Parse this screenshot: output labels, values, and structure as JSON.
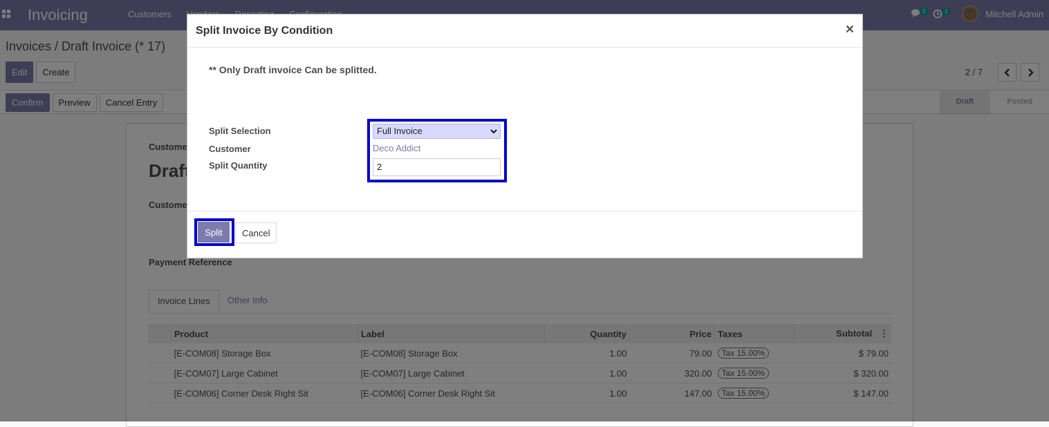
{
  "navbar": {
    "brand": "Invoicing",
    "menu": [
      "Customers",
      "Vendors",
      "Reporting",
      "Configuration"
    ],
    "messages_count": "5",
    "activities_count": "2",
    "user_name": "Mitchell Admin"
  },
  "breadcrumb": "Invoices / Draft Invoice (* 17)",
  "control": {
    "edit_label": "Edit",
    "create_label": "Create",
    "pager": "2 / 7"
  },
  "status": {
    "actions": [
      "Confirm",
      "Preview",
      "Cancel Entry"
    ],
    "stages": [
      "Draft",
      "Posted"
    ],
    "active_stage": "Draft"
  },
  "form": {
    "customer_invoice_label": "Customer Invoice",
    "title": "Draft",
    "customer_label": "Customer",
    "payment_reference_label": "Payment Reference",
    "tabs": [
      "Invoice Lines",
      "Other Info"
    ],
    "columns": [
      "Product",
      "Label",
      "Quantity",
      "Price",
      "Taxes",
      "Subtotal"
    ],
    "lines": [
      {
        "product": "[E-COM08] Storage Box",
        "label": "[E-COM08] Storage Box",
        "quantity": "1.00",
        "price": "79.00",
        "taxes": "Tax 15.00%",
        "subtotal": "$ 79.00"
      },
      {
        "product": "[E-COM07] Large Cabinet",
        "label": "[E-COM07] Large Cabinet",
        "quantity": "1.00",
        "price": "320.00",
        "taxes": "Tax 15.00%",
        "subtotal": "$ 320.00"
      },
      {
        "product": "[E-COM06] Corner Desk Right Sit",
        "label": "[E-COM06] Corner Desk Right Sit",
        "quantity": "1.00",
        "price": "147.00",
        "taxes": "Tax 15.00%",
        "subtotal": "$ 147.00"
      }
    ]
  },
  "modal": {
    "title": "Split Invoice By Condition",
    "close": "×",
    "note": "** Only Draft invoice Can be splitted.",
    "split_selection_label": "Split Selection",
    "split_selection_value": "Full Invoice",
    "customer_label": "Customer",
    "customer_value": "Deco Addict",
    "split_quantity_label": "Split Quantity",
    "split_quantity_value": "2",
    "split_button": "Split",
    "cancel_button": "Cancel"
  },
  "colors": {
    "brand": "#7c7bad",
    "highlight": "#0000cc",
    "badge": "#00a09d"
  }
}
